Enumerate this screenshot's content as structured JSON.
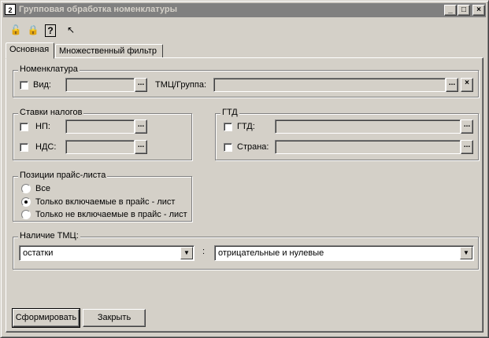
{
  "window": {
    "title": "Групповая обработка номенклатуры",
    "icon_text": "2"
  },
  "window_controls": {
    "minimize": "_",
    "maximize": "□",
    "close": "×"
  },
  "toolbar": {
    "icons": [
      "lock-open-icon",
      "lock-closed-icon",
      "help-icon",
      "pointer-help-icon"
    ],
    "glyphs": [
      "🔓",
      "🔒",
      "?",
      "↖"
    ]
  },
  "tabs": [
    {
      "label": "Основная",
      "active": true
    },
    {
      "label": "Множественный фильтр",
      "active": false
    }
  ],
  "nomenclature": {
    "legend": "Номенклатура",
    "vid_label": "Вид:",
    "group_label": "ТМЦ/Группа:",
    "browse": "...",
    "clear": "×"
  },
  "taxes": {
    "legend": "Ставки налогов",
    "np_label": "НП:",
    "nds_label": "НДС:"
  },
  "gtd": {
    "legend": "ГТД",
    "gtd_label": "ГТД:",
    "country_label": "Страна:"
  },
  "price_list": {
    "legend": "Позиции прайс-листа",
    "options": [
      "Все",
      "Только включаемые в прайс - лист",
      "Только не включаемые в прайс - лист"
    ],
    "selected": 1
  },
  "stock": {
    "legend": "Наличие ТМЦ:",
    "left_value": "остатки",
    "separator": ":",
    "right_value": "отрицательные и нулевые",
    "arrow": "▼"
  },
  "buttons": {
    "generate": "Сформировать",
    "close": "Закрыть"
  }
}
